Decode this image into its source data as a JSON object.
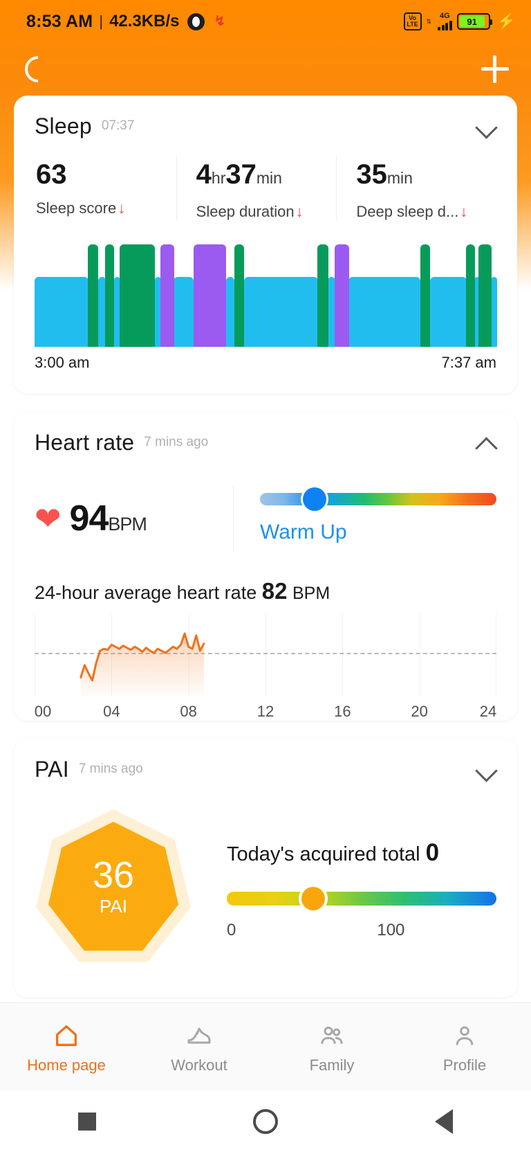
{
  "status_bar": {
    "time": "8:53 AM",
    "separator": "|",
    "data_speed": "42.3KB/s",
    "volte_top": "Vo",
    "volte_bottom": "LTE",
    "network": "4G",
    "battery_percent": "91",
    "signal_arrows": "⇅"
  },
  "header": {
    "refresh_icon": "loading-spinner",
    "add_icon": "plus-icon"
  },
  "sleep": {
    "title": "Sleep",
    "time": "07:37",
    "collapse_state": "collapsed",
    "stats": [
      {
        "value": "63",
        "unit": "",
        "label": "Sleep score",
        "trend": "↓"
      },
      {
        "value": "4",
        "unit": "hr",
        "value2": "37",
        "unit2": "min",
        "label": "Sleep duration",
        "trend": "↓"
      },
      {
        "value": "35",
        "unit": "min",
        "label": "Deep sleep d...",
        "trend": "↓"
      }
    ],
    "start_time": "3:00 am",
    "end_time": "7:37 am",
    "legend": {
      "light": "#22BDEF",
      "deep": "#079B5B",
      "rem": "#9B5BF0"
    },
    "chart_data": {
      "type": "bar",
      "title": "Sleep stages hypnogram",
      "xlabel": "",
      "ylabel": "",
      "x_range": [
        "3:00 am",
        "7:37 am"
      ],
      "categories": [
        "light",
        "deep",
        "rem"
      ],
      "segments": [
        {
          "stage": "light",
          "start_pct": 0.0,
          "width_pct": 11.6,
          "height_pct": 68
        },
        {
          "stage": "deep",
          "start_pct": 11.6,
          "width_pct": 2.1,
          "height_pct": 100
        },
        {
          "stage": "light",
          "start_pct": 13.7,
          "width_pct": 1.6,
          "height_pct": 68
        },
        {
          "stage": "deep",
          "start_pct": 15.3,
          "width_pct": 1.9,
          "height_pct": 100
        },
        {
          "stage": "light",
          "start_pct": 17.2,
          "width_pct": 1.2,
          "height_pct": 68
        },
        {
          "stage": "deep",
          "start_pct": 18.4,
          "width_pct": 7.6,
          "height_pct": 100
        },
        {
          "stage": "light",
          "start_pct": 26.0,
          "width_pct": 1.3,
          "height_pct": 68
        },
        {
          "stage": "rem",
          "start_pct": 27.3,
          "width_pct": 2.8,
          "height_pct": 100
        },
        {
          "stage": "light",
          "start_pct": 30.1,
          "width_pct": 4.3,
          "height_pct": 68
        },
        {
          "stage": "rem",
          "start_pct": 34.4,
          "width_pct": 7.0,
          "height_pct": 100
        },
        {
          "stage": "light",
          "start_pct": 41.4,
          "width_pct": 1.8,
          "height_pct": 68
        },
        {
          "stage": "deep",
          "start_pct": 43.2,
          "width_pct": 2.1,
          "height_pct": 100
        },
        {
          "stage": "light",
          "start_pct": 45.3,
          "width_pct": 16.0,
          "height_pct": 68
        },
        {
          "stage": "deep",
          "start_pct": 61.3,
          "width_pct": 2.2,
          "height_pct": 100
        },
        {
          "stage": "light",
          "start_pct": 63.5,
          "width_pct": 1.5,
          "height_pct": 68
        },
        {
          "stage": "rem",
          "start_pct": 65.0,
          "width_pct": 3.0,
          "height_pct": 100
        },
        {
          "stage": "light",
          "start_pct": 68.0,
          "width_pct": 15.5,
          "height_pct": 68
        },
        {
          "stage": "deep",
          "start_pct": 83.5,
          "width_pct": 2.1,
          "height_pct": 100
        },
        {
          "stage": "light",
          "start_pct": 85.6,
          "width_pct": 7.8,
          "height_pct": 68
        },
        {
          "stage": "deep",
          "start_pct": 93.4,
          "width_pct": 1.9,
          "height_pct": 100
        },
        {
          "stage": "light",
          "start_pct": 95.3,
          "width_pct": 0.8,
          "height_pct": 68
        },
        {
          "stage": "deep",
          "start_pct": 96.1,
          "width_pct": 2.7,
          "height_pct": 100
        },
        {
          "stage": "light",
          "start_pct": 98.8,
          "width_pct": 1.2,
          "height_pct": 68
        }
      ]
    }
  },
  "heart_rate": {
    "title": "Heart rate",
    "time_ago": "7 mins ago",
    "collapse_state": "expanded",
    "heart_icon": "heart-icon",
    "bpm_value": "94",
    "bpm_unit": "BPM",
    "zone_label": "Warm Up",
    "zone_position_pct": 23,
    "zone_dot_color": "#0E82F2",
    "avg_title_prefix": "24-hour average heart rate",
    "avg_value": "82",
    "avg_unit": "BPM",
    "chart_data": {
      "type": "line",
      "title": "24-hour heart rate",
      "xlabel": "",
      "ylabel": "BPM",
      "line_color": "#F2701B",
      "average_line": 82,
      "grid": true,
      "legend": "none",
      "xlim": [
        0,
        24
      ],
      "ylim": [
        40,
        120
      ],
      "xticks": [
        "00",
        "04",
        "08",
        "12",
        "16",
        "20",
        "24"
      ],
      "x": [
        2.4,
        2.6,
        2.8,
        3.0,
        3.2,
        3.4,
        3.6,
        3.8,
        4.0,
        4.2,
        4.4,
        4.6,
        4.8,
        5.0,
        5.2,
        5.4,
        5.6,
        5.8,
        6.0,
        6.2,
        6.4,
        6.6,
        6.8,
        7.0,
        7.2,
        7.4,
        7.6,
        7.8,
        8.0,
        8.2,
        8.4,
        8.6,
        8.8
      ],
      "y": [
        58,
        70,
        62,
        55,
        72,
        84,
        86,
        85,
        90,
        88,
        86,
        89,
        87,
        85,
        88,
        86,
        83,
        87,
        84,
        82,
        86,
        84,
        82,
        85,
        88,
        86,
        90,
        101,
        88,
        86,
        99,
        84,
        91
      ]
    }
  },
  "pai": {
    "title": "PAI",
    "time_ago": "7 mins ago",
    "collapse_state": "collapsed",
    "score": "36",
    "score_unit": "PAI",
    "total_label": "Today's acquired total",
    "total_value": "0",
    "scale_min": "0",
    "scale_max": "100",
    "dot_position_pct": 32,
    "hept_color": "#FBAB10",
    "hept_halo_color": "#FDF0D4"
  },
  "bottom_nav": {
    "items": [
      {
        "label": "Home page",
        "icon": "home-icon",
        "active": true
      },
      {
        "label": "Workout",
        "icon": "shoe-icon",
        "active": false
      },
      {
        "label": "Family",
        "icon": "family-icon",
        "active": false
      },
      {
        "label": "Profile",
        "icon": "person-icon",
        "active": false
      }
    ],
    "active_color": "#F3701A"
  },
  "system_nav": {
    "recent": "square-icon",
    "home": "circle-icon",
    "back": "triangle-icon"
  }
}
